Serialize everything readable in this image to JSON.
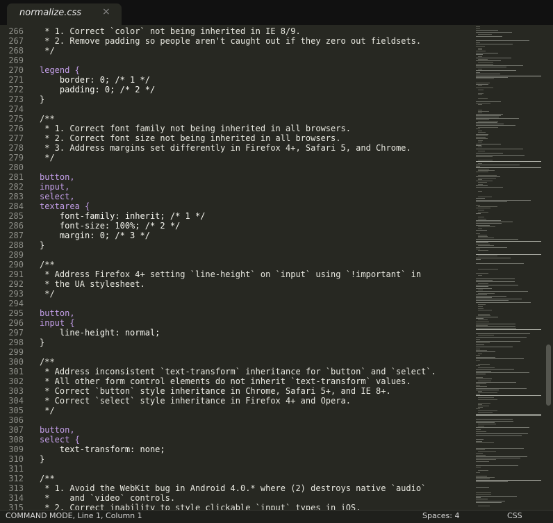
{
  "tab": {
    "title": "normalize.css",
    "close": "×"
  },
  "lines": [
    {
      "n": "266",
      "text": " * 1. Correct `color` not being inherited in IE 8/9.",
      "kind": "comment"
    },
    {
      "n": "267",
      "text": " * 2. Remove padding so people aren't caught out if they zero out fieldsets.",
      "kind": "comment"
    },
    {
      "n": "268",
      "text": " */",
      "kind": "comment"
    },
    {
      "n": "269",
      "text": "",
      "kind": "code"
    },
    {
      "n": "270",
      "text": "legend {",
      "kind": "selector"
    },
    {
      "n": "271",
      "text": "    border: 0; /* 1 */",
      "kind": "code"
    },
    {
      "n": "272",
      "text": "    padding: 0; /* 2 */",
      "kind": "code"
    },
    {
      "n": "273",
      "text": "}",
      "kind": "code"
    },
    {
      "n": "274",
      "text": "",
      "kind": "code"
    },
    {
      "n": "275",
      "text": "/**",
      "kind": "comment"
    },
    {
      "n": "276",
      "text": " * 1. Correct font family not being inherited in all browsers.",
      "kind": "comment"
    },
    {
      "n": "277",
      "text": " * 2. Correct font size not being inherited in all browsers.",
      "kind": "comment"
    },
    {
      "n": "278",
      "text": " * 3. Address margins set differently in Firefox 4+, Safari 5, and Chrome.",
      "kind": "comment"
    },
    {
      "n": "279",
      "text": " */",
      "kind": "comment"
    },
    {
      "n": "280",
      "text": "",
      "kind": "code"
    },
    {
      "n": "281",
      "text": "button,",
      "kind": "selector"
    },
    {
      "n": "282",
      "text": "input,",
      "kind": "selector"
    },
    {
      "n": "283",
      "text": "select,",
      "kind": "selector"
    },
    {
      "n": "284",
      "text": "textarea {",
      "kind": "selector"
    },
    {
      "n": "285",
      "text": "    font-family: inherit; /* 1 */",
      "kind": "code"
    },
    {
      "n": "286",
      "text": "    font-size: 100%; /* 2 */",
      "kind": "code"
    },
    {
      "n": "287",
      "text": "    margin: 0; /* 3 */",
      "kind": "code"
    },
    {
      "n": "288",
      "text": "}",
      "kind": "code"
    },
    {
      "n": "289",
      "text": "",
      "kind": "code"
    },
    {
      "n": "290",
      "text": "/**",
      "kind": "comment"
    },
    {
      "n": "291",
      "text": " * Address Firefox 4+ setting `line-height` on `input` using `!important` in",
      "kind": "comment"
    },
    {
      "n": "292",
      "text": " * the UA stylesheet.",
      "kind": "comment"
    },
    {
      "n": "293",
      "text": " */",
      "kind": "comment"
    },
    {
      "n": "294",
      "text": "",
      "kind": "code"
    },
    {
      "n": "295",
      "text": "button,",
      "kind": "selector"
    },
    {
      "n": "296",
      "text": "input {",
      "kind": "selector"
    },
    {
      "n": "297",
      "text": "    line-height: normal;",
      "kind": "code"
    },
    {
      "n": "298",
      "text": "}",
      "kind": "code"
    },
    {
      "n": "299",
      "text": "",
      "kind": "code"
    },
    {
      "n": "300",
      "text": "/**",
      "kind": "comment"
    },
    {
      "n": "301",
      "text": " * Address inconsistent `text-transform` inheritance for `button` and `select`.",
      "kind": "comment"
    },
    {
      "n": "302",
      "text": " * All other form control elements do not inherit `text-transform` values.",
      "kind": "comment"
    },
    {
      "n": "303",
      "text": " * Correct `button` style inheritance in Chrome, Safari 5+, and IE 8+.",
      "kind": "comment"
    },
    {
      "n": "304",
      "text": " * Correct `select` style inheritance in Firefox 4+ and Opera.",
      "kind": "comment"
    },
    {
      "n": "305",
      "text": " */",
      "kind": "comment"
    },
    {
      "n": "306",
      "text": "",
      "kind": "code"
    },
    {
      "n": "307",
      "text": "button,",
      "kind": "selector"
    },
    {
      "n": "308",
      "text": "select {",
      "kind": "selector"
    },
    {
      "n": "309",
      "text": "    text-transform: none;",
      "kind": "code"
    },
    {
      "n": "310",
      "text": "}",
      "kind": "code"
    },
    {
      "n": "311",
      "text": "",
      "kind": "code"
    },
    {
      "n": "312",
      "text": "/**",
      "kind": "comment"
    },
    {
      "n": "313",
      "text": " * 1. Avoid the WebKit bug in Android 4.0.* where (2) destroys native `audio`",
      "kind": "comment"
    },
    {
      "n": "314",
      "text": " *    and `video` controls.",
      "kind": "comment"
    },
    {
      "n": "315",
      "text": " * 2. Correct inability to style clickable `input` types in iOS.",
      "kind": "comment"
    }
  ],
  "status": {
    "mode": "COMMAND MODE, Line 1, Column 1",
    "spaces": "Spaces: 4",
    "syntax": "CSS"
  },
  "colors": {
    "background": "#272822",
    "tab_bar": "#111111",
    "comment": "#e8e8e0",
    "selector": "#c39ee8",
    "text": "#f8f8f2",
    "gutter": "#8f908a"
  }
}
